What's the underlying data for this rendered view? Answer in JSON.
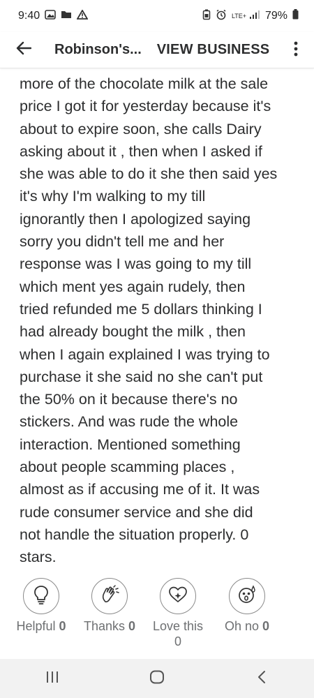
{
  "status_bar": {
    "time": "9:40",
    "battery": "79%",
    "network": "LTE+"
  },
  "app_bar": {
    "business_name": "Robinson's...",
    "view_business_label": "VIEW BUSINESS"
  },
  "review": {
    "text": "more of the chocolate milk at the sale\nprice I got it for yesterday because it's\nabout to expire soon, she calls Dairy\nasking about it , then when I asked if\nshe was able to do it she then said yes\nit's why I'm walking to my till\nignorantly then I apologized saying\nsorry you didn't tell me and her\nresponse was I was going to my till\nwhich ment yes again rudely, then\ntried refunded me 5 dollars thinking I\nhad already bought the milk , then\nwhen I again explained I was trying to\npurchase it she said no she can't put\nthe 50% on it because there's no\nstickers. And was rude the whole\ninteraction. Mentioned something\nabout people scamming places ,\nalmost as if accusing me of it. It was\nrude consumer service and she did\nnot handle the situation properly. 0\nstars."
  },
  "reactions": [
    {
      "label": "Helpful",
      "count": "0",
      "icon": "lightbulb-icon"
    },
    {
      "label": "Thanks",
      "count": "0",
      "icon": "clapping-hands-icon"
    },
    {
      "label": "Love this",
      "count": "0",
      "icon": "heart-sparkle-icon"
    },
    {
      "label": "Oh no",
      "count": "0",
      "icon": "surprised-face-icon"
    }
  ],
  "colors": {
    "text": "#2d2e2f",
    "muted": "#6e7072",
    "nav_bg": "#f2f2f2"
  }
}
